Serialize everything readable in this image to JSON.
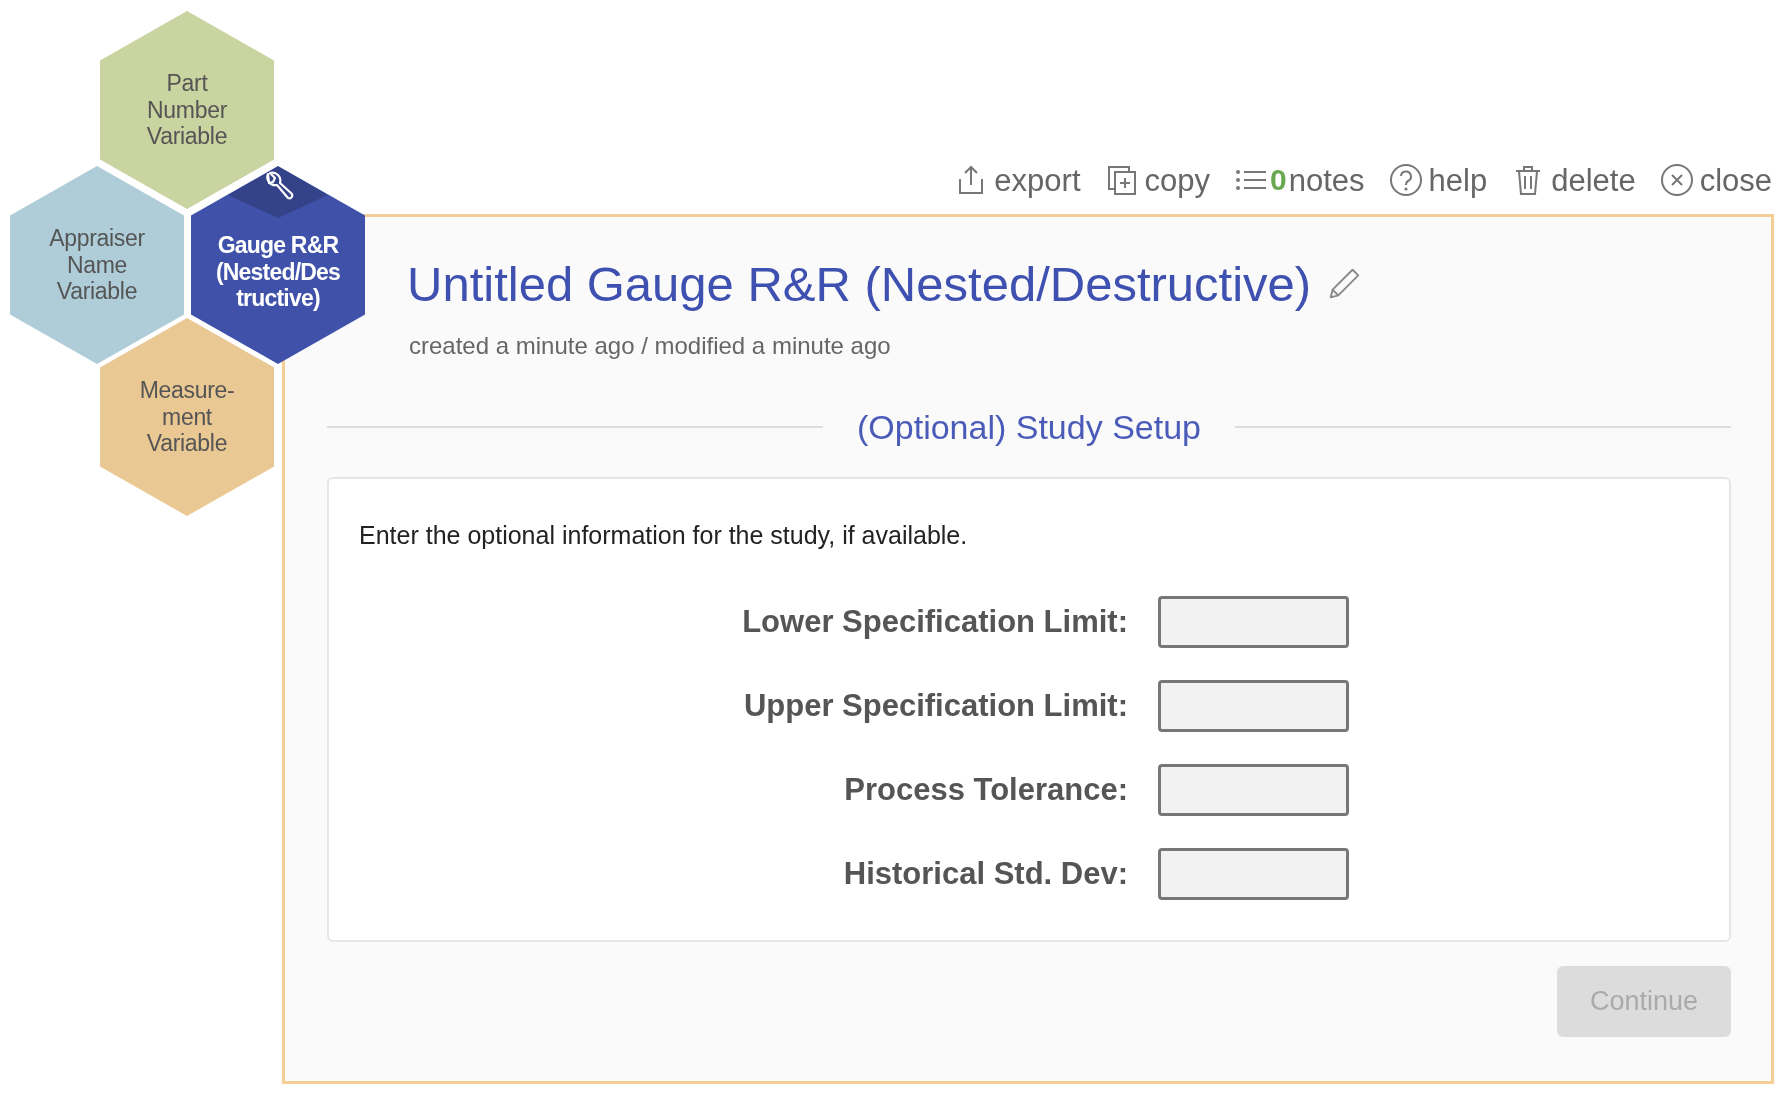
{
  "hexagons": [
    {
      "label": "Part\nNumber\nVariable",
      "color": "#c9d4a0",
      "selected": false
    },
    {
      "label": "Appraiser\nName\nVariable",
      "color": "#afcdd8",
      "selected": false
    },
    {
      "label": "Gauge R&R\n(Nested/Des\ntructive)",
      "color": "#3f51a8",
      "selected": true
    },
    {
      "label": "Measure-\nment\nVariable",
      "color": "#e9c893",
      "selected": false
    }
  ],
  "toolbar": [
    {
      "kind": "export",
      "label": "export"
    },
    {
      "kind": "copy",
      "label": "copy"
    },
    {
      "kind": "notes",
      "label": "notes",
      "count": "0"
    },
    {
      "kind": "help",
      "label": "help"
    },
    {
      "kind": "delete",
      "label": "delete"
    },
    {
      "kind": "close",
      "label": "close"
    }
  ],
  "title": "Untitled Gauge R&R (Nested/Destructive)",
  "subtitle": "created a minute ago / modified a minute ago",
  "section_title": "(Optional) Study Setup",
  "instruction": "Enter the optional information for the study, if available.",
  "fields": [
    {
      "label": "Lower Specification Limit:"
    },
    {
      "label": "Upper Specification Limit:"
    },
    {
      "label": "Process Tolerance:"
    },
    {
      "label": "Historical Std. Dev:"
    }
  ],
  "continue_button": {
    "label": "Continue",
    "disabled": true
  }
}
